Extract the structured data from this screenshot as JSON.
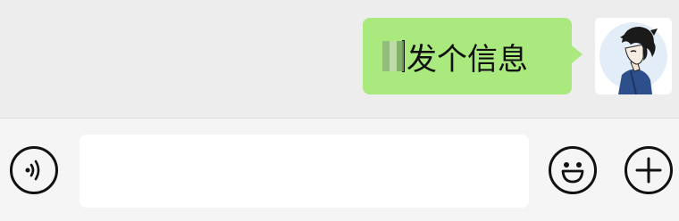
{
  "chat": {
    "message_text": "发个信息",
    "bubble_color": "#a9e97d"
  },
  "input_bar": {
    "placeholder": "",
    "voice_icon": "voice-wave-icon",
    "emoji_icon": "smiley-face-icon",
    "plus_icon": "plus-icon"
  },
  "colors": {
    "background": "#ededed",
    "input_bar": "#f5f5f5"
  }
}
